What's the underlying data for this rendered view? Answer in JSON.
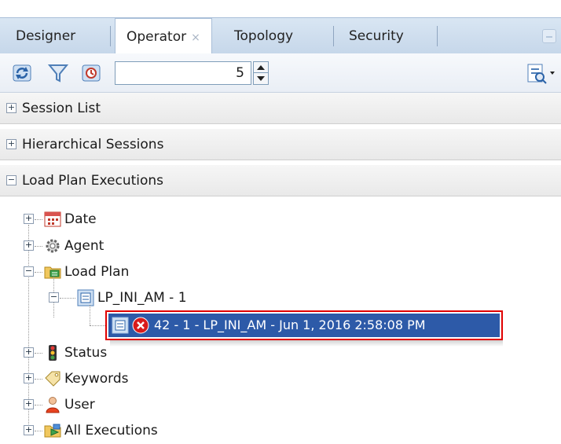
{
  "tabs": [
    {
      "label": "Designer",
      "active": false
    },
    {
      "label": "Operator",
      "active": true,
      "close": "×"
    },
    {
      "label": "Topology",
      "active": false
    },
    {
      "label": "Security",
      "active": false
    }
  ],
  "toolbar": {
    "icons": [
      "refresh-icon",
      "filter-icon",
      "auto-refresh-icon",
      "view-options-icon"
    ],
    "count_value": "5"
  },
  "sections": [
    {
      "toggle": "+",
      "label": "Session List"
    },
    {
      "toggle": "+",
      "label": "Hierarchical Sessions"
    },
    {
      "toggle": "−",
      "label": "Load Plan Executions"
    }
  ],
  "tree": {
    "date": "Date",
    "agent": "Agent",
    "load_plan": "Load Plan",
    "lp_name": "LP_INI_AM - 1",
    "execution": "42 - 1 - LP_INI_AM - Jun 1, 2016 2:58:08 PM",
    "status": "Status",
    "keywords": "Keywords",
    "user": "User",
    "all_executions": "All Executions"
  },
  "colors": {
    "tabbar": "#c6d7ea",
    "selection": "#2d5aa8",
    "highlight_border": "#e00000",
    "error_icon": "#d81b1b"
  }
}
